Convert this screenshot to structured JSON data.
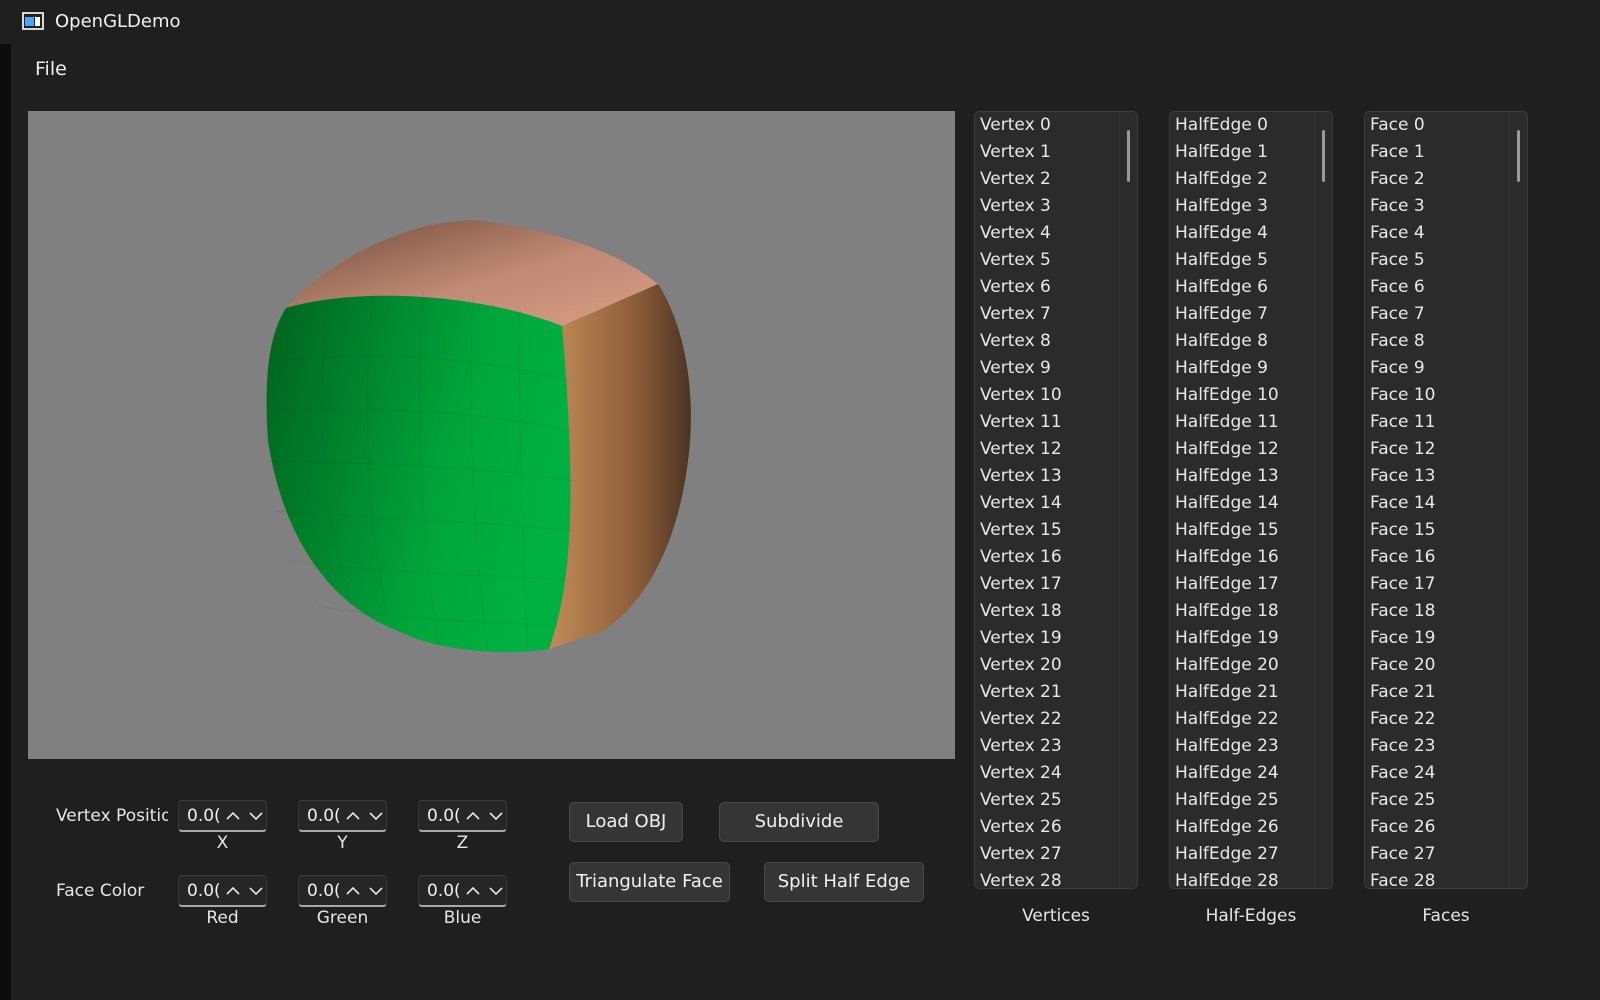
{
  "window": {
    "title": "OpenGLDemo"
  },
  "menu": {
    "file": "File"
  },
  "controls": {
    "vertex_position": {
      "label": "Vertex Positio",
      "fields": [
        {
          "value": "0.0(",
          "axis": "X"
        },
        {
          "value": "0.0(",
          "axis": "Y"
        },
        {
          "value": "0.0(",
          "axis": "Z"
        }
      ]
    },
    "face_color": {
      "label": "Face Color",
      "fields": [
        {
          "value": "0.0(",
          "axis": "Red"
        },
        {
          "value": "0.0(",
          "axis": "Green"
        },
        {
          "value": "0.0(",
          "axis": "Blue"
        }
      ]
    },
    "buttons": {
      "load_obj": "Load OBJ",
      "subdivide": "Subdivide",
      "triangulate_face": "Triangulate Face",
      "split_half_edge": "Split Half Edge"
    }
  },
  "lists": {
    "vertices": {
      "caption": "Vertices",
      "prefix": "Vertex",
      "visible_count": 29
    },
    "half_edges": {
      "caption": "Half-Edges",
      "prefix": "HalfEdge",
      "visible_count": 29
    },
    "faces": {
      "caption": "Faces",
      "prefix": "Face",
      "visible_count": 29
    }
  },
  "viewport": {
    "background": "#808080",
    "face_colors": {
      "front": "#00a63c",
      "top": "#b07860",
      "side": "#b47c48"
    }
  }
}
